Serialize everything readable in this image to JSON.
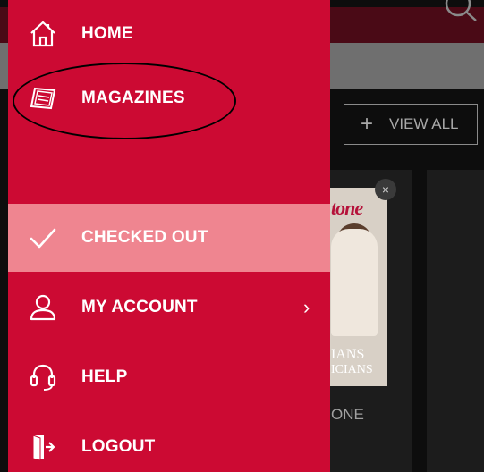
{
  "menu": {
    "items": [
      {
        "id": "home",
        "label": "HOME",
        "icon": "home-icon"
      },
      {
        "id": "magazines",
        "label": "MAGAZINES",
        "icon": "magazine-icon"
      },
      {
        "id": "checked-out",
        "label": "CHECKED OUT",
        "icon": "check-icon",
        "active": true
      },
      {
        "id": "my-account",
        "label": "MY ACCOUNT",
        "icon": "user-icon",
        "chevron": "›"
      },
      {
        "id": "help",
        "label": "HELP",
        "icon": "headset-icon"
      },
      {
        "id": "logout",
        "label": "LOGOUT",
        "icon": "logout-icon"
      }
    ]
  },
  "background": {
    "view_all_plus": "+",
    "view_all_label": "VIEW ALL",
    "card_close": "×",
    "cover_masthead": "tone",
    "cover_line1": "IANS",
    "cover_line2": "ICIANS",
    "card_title": "ONE"
  },
  "colors": {
    "drawer": "#cc0a33",
    "active_item": "#ef8590",
    "text": "#ffffff",
    "backdrop": "#0d0d0d"
  }
}
